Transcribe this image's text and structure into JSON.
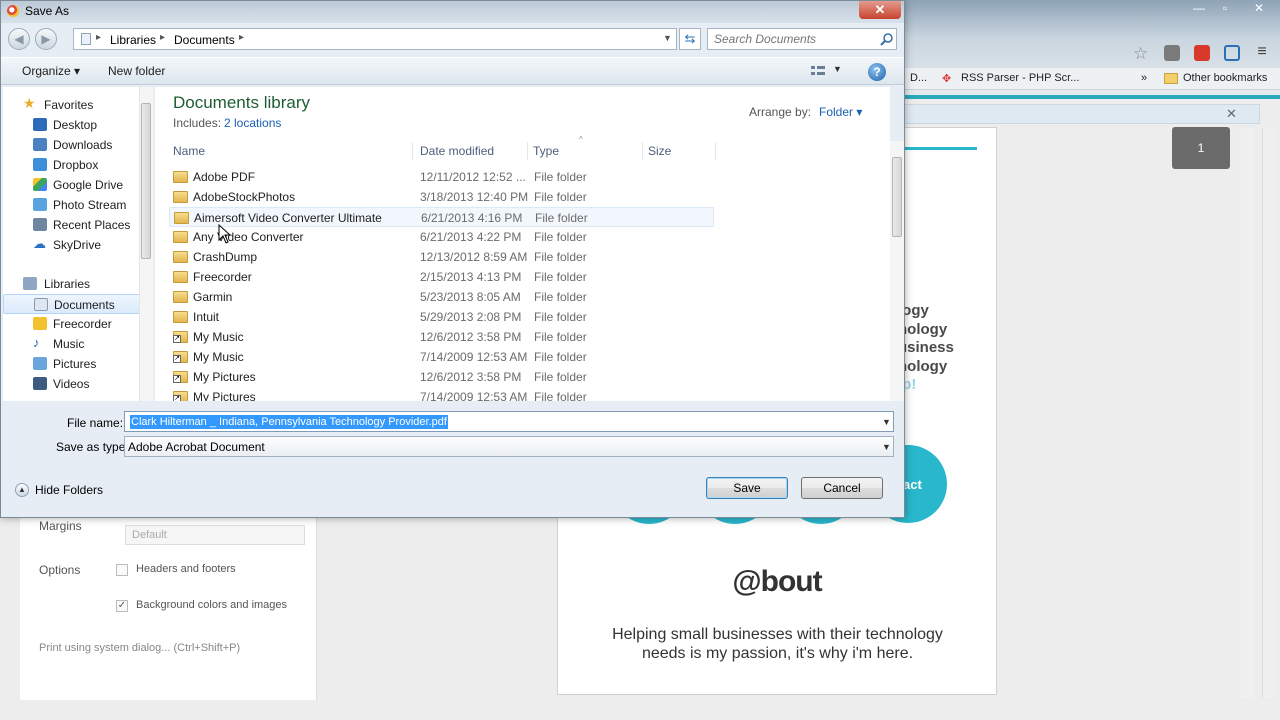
{
  "browser": {
    "bookmarks": [
      "D...",
      "RSS Parser - PHP Scr...",
      "»",
      "Other bookmarks"
    ],
    "window_controls": [
      "minimize-icon",
      "maximize-icon",
      "close-icon"
    ]
  },
  "print_panel": {
    "margins_label": "Margins",
    "margins_value": "Default",
    "options_label": "Options",
    "headers_footers_label": "Headers and footers",
    "headers_footers_checked": false,
    "bg_colors_label": "Background colors and images",
    "bg_colors_checked": true,
    "system_dialog_link": "Print using system dialog... (Ctrl+Shift+P)"
  },
  "page_preview": {
    "page_number": "1",
    "fragments": [
      "logy",
      "nology",
      "usiness",
      "nology",
      "lp!"
    ],
    "contact_fragment": "act",
    "about_heading": "@bout",
    "tagline_line1": "Helping small businesses with their technology",
    "tagline_line2": "needs is my passion, it's why i'm here."
  },
  "dialog": {
    "title": "Save As",
    "breadcrumb": [
      "Libraries",
      "Documents"
    ],
    "search_placeholder": "Search Documents",
    "toolbar": {
      "organize": "Organize ▾",
      "new_folder": "New folder",
      "help": "?"
    },
    "nav_pane": {
      "favorites_header": "Favorites",
      "favorites": [
        "Desktop",
        "Downloads",
        "Dropbox",
        "Google Drive",
        "Photo Stream",
        "Recent Places",
        "SkyDrive"
      ],
      "libraries_header": "Libraries",
      "libraries": [
        "Documents",
        "Freecorder",
        "Music",
        "Pictures",
        "Videos"
      ],
      "selected": "Documents"
    },
    "library": {
      "title": "Documents library",
      "includes_label": "Includes:",
      "locations_link": "2 locations",
      "arrange_by_label": "Arrange by:",
      "arrange_by_value": "Folder ▾"
    },
    "columns": [
      "Name",
      "Date modified",
      "Type",
      "Size"
    ],
    "files": [
      {
        "name": "Adobe PDF",
        "date": "12/11/2012 12:52 ...",
        "type": "File folder",
        "link": false
      },
      {
        "name": "AdobeStockPhotos",
        "date": "3/18/2013 12:40 PM",
        "type": "File folder",
        "link": false
      },
      {
        "name": "Aimersoft Video Converter Ultimate",
        "date": "6/21/2013 4:16 PM",
        "type": "File folder",
        "link": false
      },
      {
        "name": "Any Video Converter",
        "date": "6/21/2013 4:22 PM",
        "type": "File folder",
        "link": false
      },
      {
        "name": "CrashDump",
        "date": "12/13/2012 8:59 AM",
        "type": "File folder",
        "link": false
      },
      {
        "name": "Freecorder",
        "date": "2/15/2013 4:13 PM",
        "type": "File folder",
        "link": false
      },
      {
        "name": "Garmin",
        "date": "5/23/2013 8:05 AM",
        "type": "File folder",
        "link": false
      },
      {
        "name": "Intuit",
        "date": "5/29/2013 2:08 PM",
        "type": "File folder",
        "link": false
      },
      {
        "name": "My Music",
        "date": "12/6/2012 3:58 PM",
        "type": "File folder",
        "link": true
      },
      {
        "name": "My Music",
        "date": "7/14/2009 12:53 AM",
        "type": "File folder",
        "link": true
      },
      {
        "name": "My Pictures",
        "date": "12/6/2012 3:58 PM",
        "type": "File folder",
        "link": true
      },
      {
        "name": "My Pictures",
        "date": "7/14/2009 12:53 AM",
        "type": "File folder",
        "link": true
      }
    ],
    "file_name_label": "File name:",
    "file_name_value": "Clark Hilterman _ Indiana, Pennsylvania Technology Provider.pdf",
    "save_type_label": "Save as type:",
    "save_type_value": "Adobe Acrobat Document",
    "hide_folders": "Hide Folders",
    "save_button": "Save",
    "cancel_button": "Cancel"
  },
  "colors": {
    "accent_teal": "#29b7cc",
    "library_title": "#1e5d33",
    "link_blue": "#1a5fb4",
    "selection_blue": "#3399ff"
  }
}
